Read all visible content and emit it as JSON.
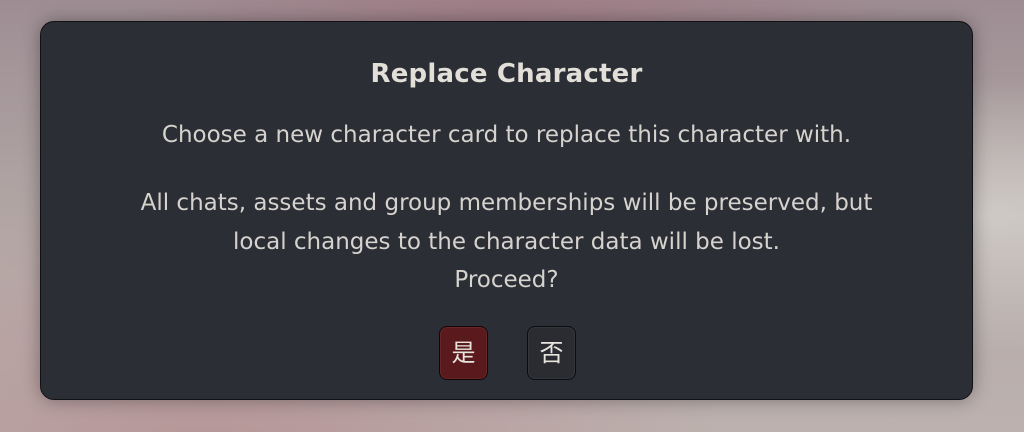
{
  "dialog": {
    "title": "Replace Character",
    "subtitle": "Choose a new character card to replace this character with.",
    "body_line_1": "All chats, assets and group memberships will be preserved, but",
    "body_line_2": "local changes to the character data will be lost.",
    "proceed": "Proceed?",
    "yes_label": "是",
    "no_label": "否",
    "colors": {
      "dialog_bg": "#2b2e35",
      "yes_button": "#5a1a1d",
      "no_button": "#2a2c32"
    }
  }
}
